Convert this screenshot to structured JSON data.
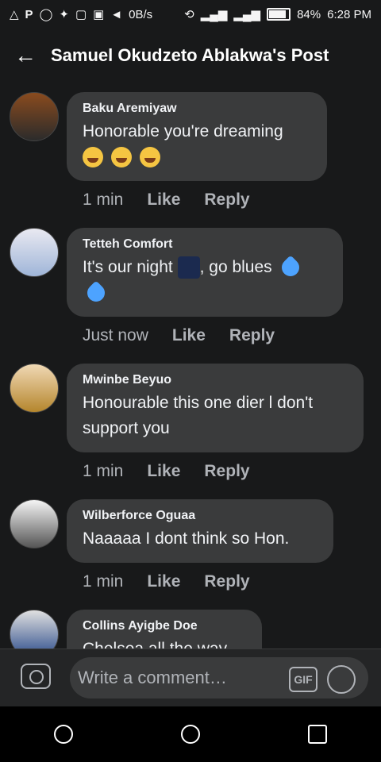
{
  "status_bar": {
    "left_icons": [
      "alert-icon",
      "p-icon",
      "whatsapp-icon",
      "twitter-icon",
      "image-icon",
      "lock-icon",
      "telegram-icon"
    ],
    "speed": "0B/s",
    "battery": "84%",
    "time": "6:28 PM"
  },
  "header": {
    "title": "Samuel Okudzeto Ablakwa's Post"
  },
  "comments": [
    {
      "author": "Baku Aremiyaw",
      "text": "Honorable you're dreaming",
      "time": "1 min",
      "like": "Like",
      "reply": "Reply"
    },
    {
      "author": "Tetteh Comfort",
      "text1": "It's our night",
      "text2": ", go blues",
      "time": "Just now",
      "like": "Like",
      "reply": "Reply"
    },
    {
      "author": "Mwinbe Beyuo",
      "text": "Honourable this one dier l don't support you",
      "time": "1 min",
      "like": "Like",
      "reply": "Reply"
    },
    {
      "author": "Wilberforce Oguaa",
      "text": "Naaaaa I dont think so Hon.",
      "time": "1 min",
      "like": "Like",
      "reply": "Reply"
    },
    {
      "author": "Collins Ayigbe Doe",
      "text": "Chelsea all the way"
    }
  ],
  "composer": {
    "placeholder": "Write a comment…",
    "gif": "GIF"
  },
  "colors": {
    "background": "#18191a",
    "bubble": "#3a3b3c",
    "accent": "#4da3ff"
  }
}
